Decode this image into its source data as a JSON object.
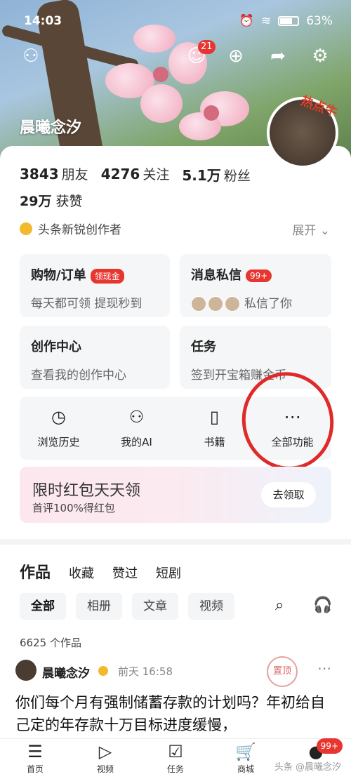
{
  "status_bar": {
    "time": "14:03",
    "battery": "63%"
  },
  "hero": {
    "name": "晨曦念汐",
    "notif_count": "21",
    "avatar_tag": "热点牛"
  },
  "stats": {
    "friends_num": "3843",
    "friends_lbl": "朋友",
    "follow_num": "4276",
    "follow_lbl": "关注",
    "fans_num": "5.1万",
    "fans_lbl": "粉丝",
    "likes_num": "29万",
    "likes_lbl": "获赞"
  },
  "creator": {
    "label": "头条新锐创作者",
    "expand": "展开"
  },
  "cards": [
    {
      "title": "购物/订单",
      "badge": "领现金",
      "sub": "每天都可领 提现秒到"
    },
    {
      "title": "消息私信",
      "badge": "99+",
      "sub": "私信了你"
    },
    {
      "title": "创作中心",
      "sub": "查看我的创作中心"
    },
    {
      "title": "任务",
      "sub": "签到开宝箱赚金币"
    }
  ],
  "funcs": [
    {
      "label": "浏览历史"
    },
    {
      "label": "我的AI"
    },
    {
      "label": "书籍"
    },
    {
      "label": "全部功能"
    }
  ],
  "banner": {
    "title": "限时红包天天领",
    "sub": "首评100%得红包",
    "button": "去领取"
  },
  "tabs": [
    {
      "label": "作品"
    },
    {
      "label": "收藏"
    },
    {
      "label": "赞过"
    },
    {
      "label": "短剧"
    }
  ],
  "filters": [
    {
      "label": "全部"
    },
    {
      "label": "相册"
    },
    {
      "label": "文章"
    },
    {
      "label": "视频"
    }
  ],
  "count": "6625 个作品",
  "post": {
    "name": "晨曦念汐",
    "time": "前天 16:58",
    "pin": "置顶",
    "text": "你们每个月有强制储蓄存款的计划吗？年初给自己定的年存款十万目标进度缓慢，"
  },
  "nav": [
    {
      "label": "首页"
    },
    {
      "label": "视频"
    },
    {
      "label": "任务"
    },
    {
      "label": "商城"
    },
    {
      "label": ""
    }
  ],
  "nav_badge": "99+",
  "watermark": "头条 @晨曦念汐"
}
